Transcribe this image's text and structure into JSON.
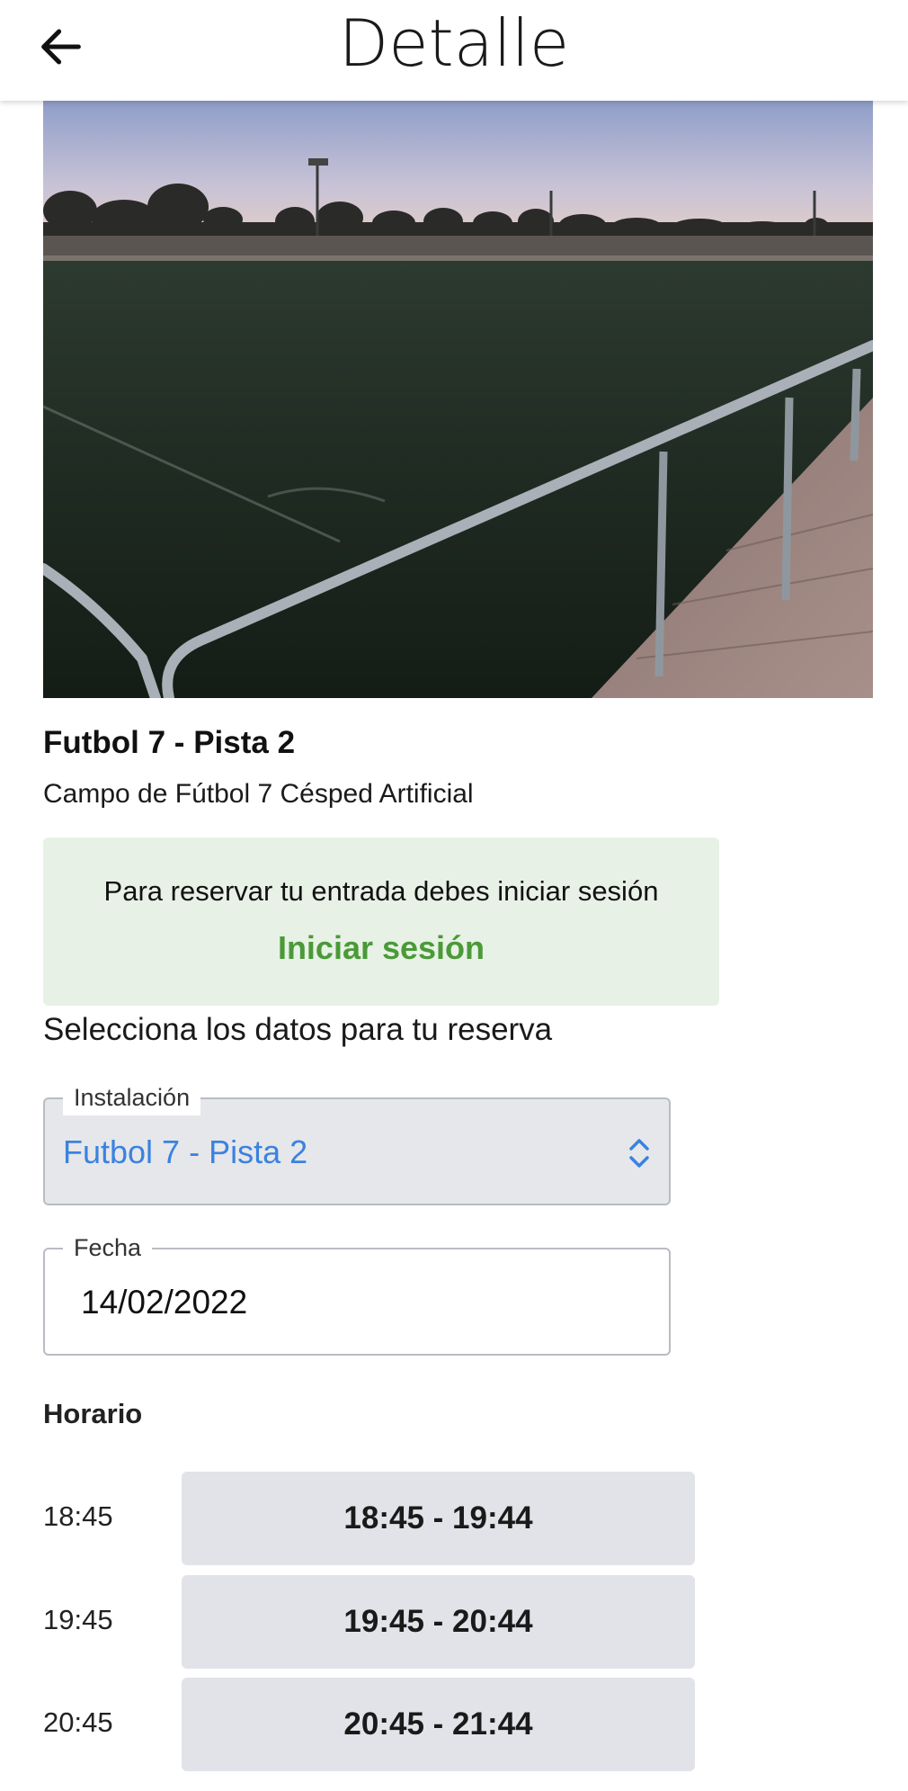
{
  "header": {
    "title": "Detalle",
    "back_icon": "arrow-left-icon"
  },
  "facility": {
    "name": "Futbol 7 - Pista 2",
    "description": "Campo de Fútbol 7 Césped Artificial"
  },
  "login_banner": {
    "message": "Para reservar tu entrada debes iniciar sesión",
    "link_label": "Iniciar sesión",
    "background_color": "#e8f1e6",
    "link_color": "#4a9a38"
  },
  "booking": {
    "section_title": "Selecciona los datos para tu reserva",
    "installation": {
      "label": "Instalación",
      "value": "Futbol 7 - Pista 2",
      "value_color": "#3b82e0"
    },
    "date": {
      "label": "Fecha",
      "value": "14/02/2022"
    },
    "schedule_title": "Horario",
    "slots": [
      {
        "time": "18:45",
        "range": "18:45 - 19:44"
      },
      {
        "time": "19:45",
        "range": "19:45 - 20:44"
      },
      {
        "time": "20:45",
        "range": "20:45 - 21:44"
      }
    ]
  }
}
